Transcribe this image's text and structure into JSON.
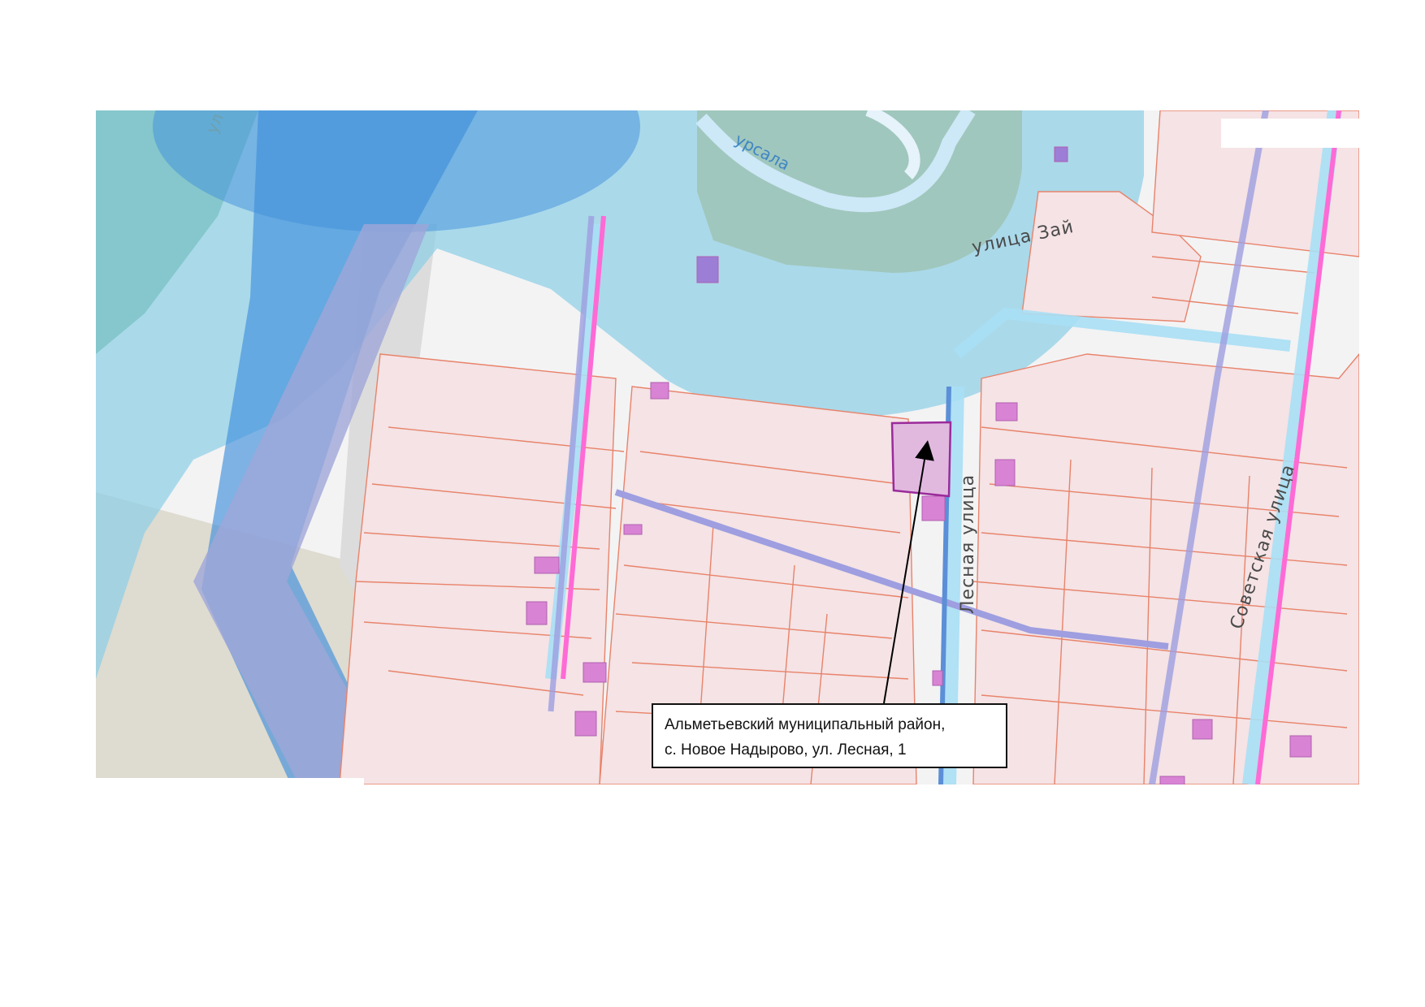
{
  "map": {
    "streets": {
      "lesnaya": "Лесная  улица",
      "zai": "улица  Зай",
      "sovetskaya": "Советская  улица"
    },
    "river_label": "урсала",
    "edge_label": "ул",
    "colors": {
      "parcel_fill": "#f5e3e5",
      "parcel_border": "#e8836a",
      "building": "#d983d4",
      "target_parcel": "#e1b9df",
      "target_border": "#9b2a9b",
      "water_zone": "#8ecfe6",
      "protection_zone": "#3f8fdc",
      "river": "#cde8f7",
      "forest": "#6fb58a",
      "road_line": "#9e9ee0",
      "street_line": "#ff6ad5"
    },
    "callout": {
      "line1": "Альметьевский муниципальный район,",
      "line2": "с. Новое Надырово, ул. Лесная, 1"
    }
  }
}
